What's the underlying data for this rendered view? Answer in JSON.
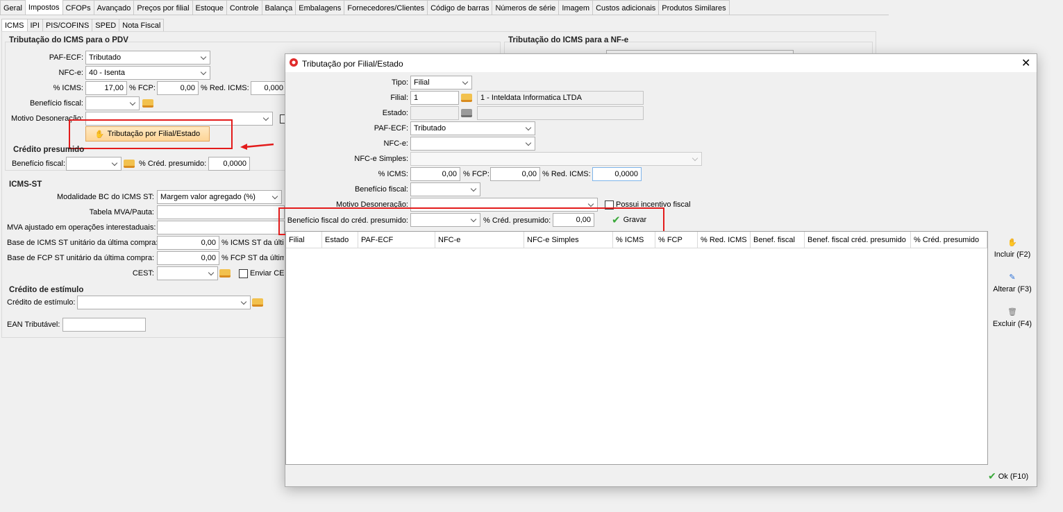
{
  "tabs": [
    "Geral",
    "Impostos",
    "CFOPs",
    "Avançado",
    "Preços por filial",
    "Estoque",
    "Controle",
    "Balança",
    "Embalagens",
    "Fornecedores/Clientes",
    "Código de barras",
    "Números de série",
    "Imagem",
    "Custos adicionais",
    "Produtos Similares"
  ],
  "subtabs": [
    "ICMS",
    "IPI",
    "PIS/COFINS",
    "SPED",
    "Nota Fiscal"
  ],
  "pdv": {
    "title": "Tributação do ICMS para o PDV",
    "paf_label": "PAF-ECF:",
    "paf_value": "Tributado",
    "nfce_label": "NFC-e:",
    "nfce_value": "40 - Isenta",
    "icms_label": "% ICMS:",
    "icms_value": "17,00",
    "fcp_label": "% FCP:",
    "fcp_value": "0,00",
    "red_label": "% Red. ICMS:",
    "red_value": "0,000",
    "benef_label": "Benefício fiscal:",
    "motivo_label": "Motivo Desoneração:",
    "btn_label": "Tributação por Filial/Estado"
  },
  "credito": {
    "title": "Crédito presumido",
    "benef_label": "Benefício fiscal:",
    "pct_label": "% Créd. presumido:",
    "pct_value": "0,0000"
  },
  "st": {
    "title": "ICMS-ST",
    "modalidade_label": "Modalidade BC do ICMS ST:",
    "modalidade_value": "Margem valor agregado (%)",
    "mva_label": "Tabela MVA/Pauta:",
    "mva_ajust_label": "MVA ajustado em operações interestaduais:",
    "base_icms_label": "Base de ICMS ST unitário da última compra:",
    "base_icms_value": "0,00",
    "icms_st_label": "% ICMS ST da últim",
    "base_fcp_label": "Base de FCP ST unitário da última compra:",
    "base_fcp_value": "0,00",
    "fcp_st_label": "% FCP ST da últim",
    "cest_label": "CEST:",
    "enviar_label": "Enviar CES"
  },
  "estimulo": {
    "title": "Crédito de estímulo",
    "label": "Crédito de estímulo:"
  },
  "ean": {
    "label": "EAN Tributável:"
  },
  "nfe": {
    "title": "Tributação do ICMS para a NF-e"
  },
  "dialog": {
    "title": "Tributação por Filial/Estado",
    "tipo_label": "Tipo:",
    "tipo_value": "Filial",
    "filial_label": "Filial:",
    "filial_value": "1",
    "filial_name": "1 - Inteldata Informatica LTDA",
    "estado_label": "Estado:",
    "paf_label": "PAF-ECF:",
    "paf_value": "Tributado",
    "nfce_label": "NFC-e:",
    "nfces_label": "NFC-e Simples:",
    "icms_label": "% ICMS:",
    "icms_value": "0,00",
    "fcp_label": "% FCP:",
    "fcp_value": "0,00",
    "red_label": "% Red. ICMS:",
    "red_value": "0,0000",
    "benef_label": "Benefício fiscal:",
    "motivo_label": "Motivo Desoneração:",
    "incentivo_label": "Possui incentivo fiscal",
    "benef_cred_label": "Benefício fiscal do créd. presumido:",
    "pct_cred_label": "% Créd. presumido:",
    "pct_cred_value": "0,00",
    "gravar_label": "Gravar",
    "columns": [
      "Filial",
      "Estado",
      "PAF-ECF",
      "NFC-e",
      "NFC-e Simples",
      "% ICMS",
      "% FCP",
      "% Red. ICMS",
      "Benef. fiscal",
      "Benef. fiscal créd. presumido",
      "% Créd. presumido"
    ],
    "incluir": "Incluir (F2)",
    "alterar": "Alterar (F3)",
    "excluir": "Excluir (F4)",
    "ok": "Ok (F10)"
  }
}
